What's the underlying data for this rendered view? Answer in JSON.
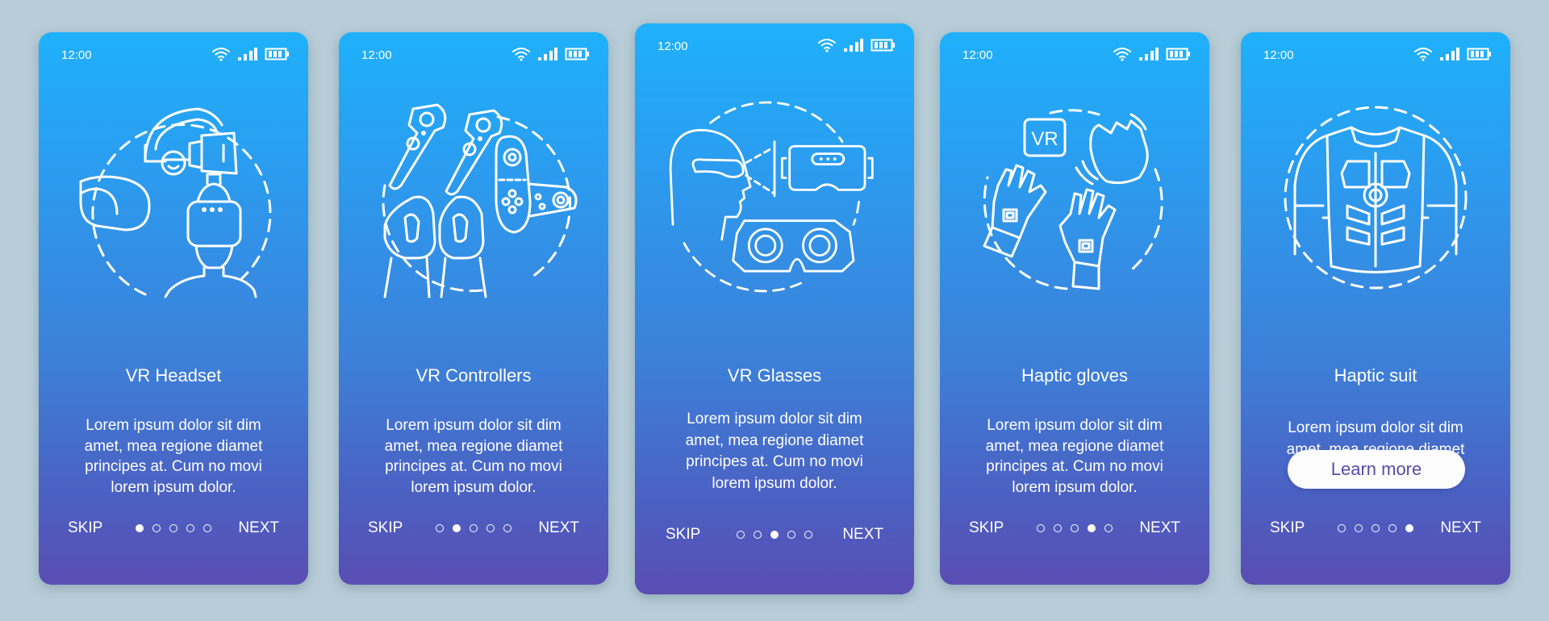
{
  "status_bar": {
    "time": "12:00",
    "icons": [
      "wifi-icon",
      "signal-icon",
      "battery-icon"
    ]
  },
  "nav": {
    "skip_label": "SKIP",
    "next_label": "NEXT",
    "total_pages": 5
  },
  "colors": {
    "gradient_top": "#1fb1fb",
    "gradient_bottom": "#5a4db3",
    "background": "#b8cdd7",
    "button_text": "#5a4aa8"
  },
  "screens": [
    {
      "title": "VR Headset",
      "illustration": "vr-headset-illustration",
      "description": [
        "Lorem ipsum dolor sit dim",
        "amet, mea regione diamet",
        "principes at. Cum no movi",
        "lorem ipsum dolor."
      ],
      "active_page": 1
    },
    {
      "title": "VR Controllers",
      "illustration": "vr-controllers-illustration",
      "description": [
        "Lorem ipsum dolor sit dim",
        "amet, mea regione diamet",
        "principes at. Cum no movi",
        "lorem ipsum dolor."
      ],
      "active_page": 2
    },
    {
      "title": "VR Glasses",
      "illustration": "vr-glasses-illustration",
      "description": [
        "Lorem ipsum dolor sit dim",
        "amet, mea regione diamet",
        "principes at. Cum no movi",
        "lorem ipsum dolor."
      ],
      "active_page": 3
    },
    {
      "title": "Haptic gloves",
      "illustration": "haptic-gloves-illustration",
      "description": [
        "Lorem ipsum dolor sit dim",
        "amet, mea regione diamet",
        "principes at. Cum no movi",
        "lorem ipsum dolor."
      ],
      "active_page": 4
    },
    {
      "title": "Haptic suit",
      "illustration": "haptic-suit-illustration",
      "description": [
        "Lorem ipsum dolor sit dim",
        "amet, mea regione diamet"
      ],
      "button_label": "Learn more",
      "active_page": 5
    }
  ],
  "vr_badge_text": "VR"
}
